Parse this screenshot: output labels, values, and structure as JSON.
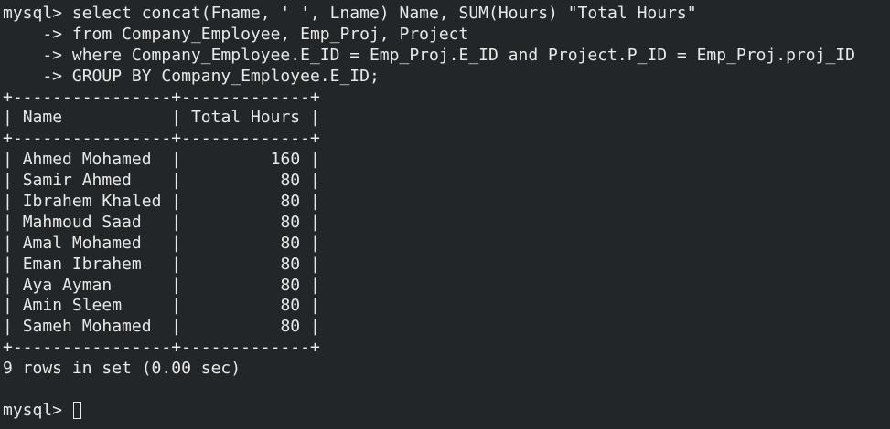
{
  "terminal": {
    "prompt": "mysql> ",
    "continuation_prompt": "    -> ",
    "query_lines": [
      "select concat(Fname, ' ', Lname) Name, SUM(Hours) \"Total Hours\"",
      "from Company_Employee, Emp_Proj, Project",
      "where Company_Employee.E_ID = Emp_Proj.E_ID and Project.P_ID = Emp_Proj.proj_ID",
      "GROUP BY Company_Employee.E_ID;"
    ],
    "table": {
      "columns": [
        "Name",
        "Total Hours"
      ],
      "rows": [
        [
          "Ahmed Mohamed",
          "160"
        ],
        [
          "Samir Ahmed",
          "80"
        ],
        [
          "Ibrahem Khaled",
          "80"
        ],
        [
          "Mahmoud Saad",
          "80"
        ],
        [
          "Amal Mohamed",
          "80"
        ],
        [
          "Eman Ibrahem",
          "80"
        ],
        [
          "Aya Ayman",
          "80"
        ],
        [
          "Amin Sleem",
          "80"
        ],
        [
          "Sameh Mohamed",
          "80"
        ]
      ]
    },
    "result_summary": "9 rows in set (0.00 sec)"
  }
}
